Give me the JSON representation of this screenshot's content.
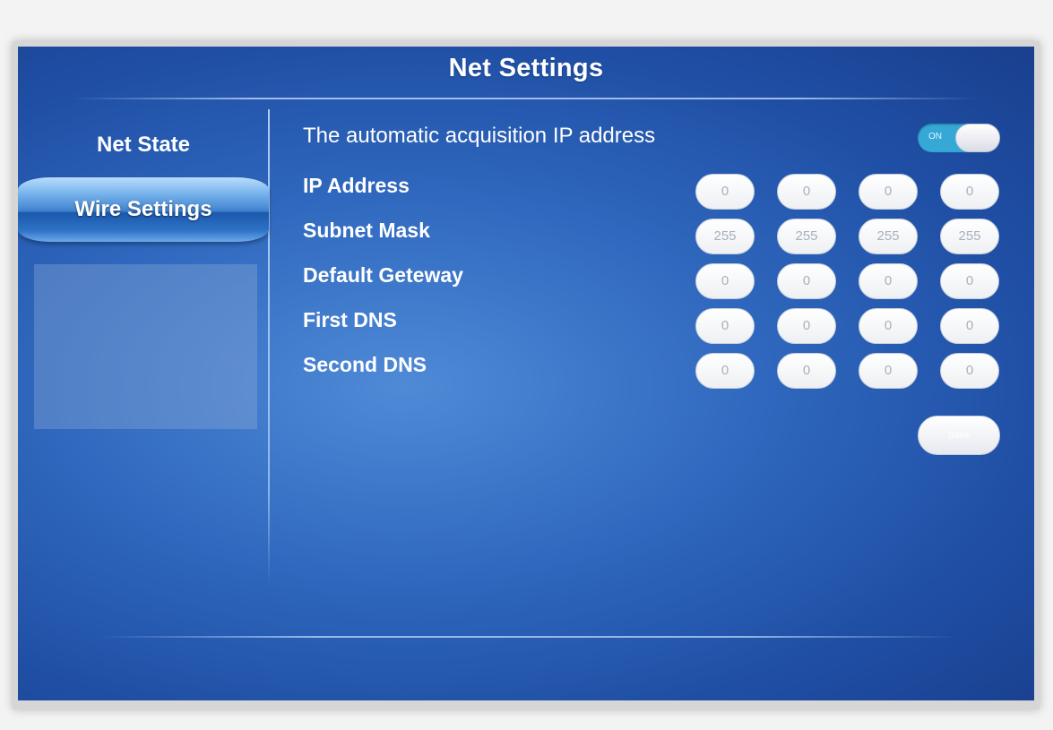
{
  "header": {
    "title": "Net Settings"
  },
  "sidebar": {
    "items": [
      {
        "label": "Net State"
      },
      {
        "label": "Wire Settings"
      }
    ]
  },
  "auto_ip": {
    "label": "The automatic acquisition IP address",
    "toggle_text": "ON"
  },
  "rows": [
    {
      "label": "IP Address",
      "octets": [
        "0",
        "0",
        "0",
        "0"
      ]
    },
    {
      "label": "Subnet Mask",
      "octets": [
        "255",
        "255",
        "255",
        "255"
      ]
    },
    {
      "label": "Default Geteway",
      "octets": [
        "0",
        "0",
        "0",
        "0"
      ]
    },
    {
      "label": "First DNS",
      "octets": [
        "0",
        "0",
        "0",
        "0"
      ]
    },
    {
      "label": "Second DNS",
      "octets": [
        "0",
        "0",
        "0",
        "0"
      ]
    }
  ],
  "actions": {
    "save_label": "Save"
  }
}
